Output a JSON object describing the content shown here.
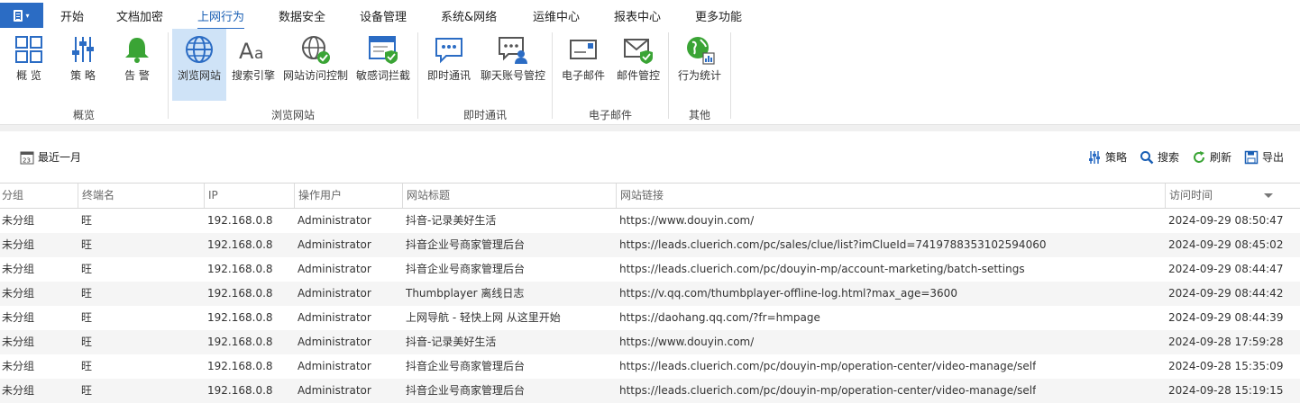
{
  "menu": {
    "items": [
      "开始",
      "文档加密",
      "上网行为",
      "数据安全",
      "设备管理",
      "系统&网络",
      "运维中心",
      "报表中心",
      "更多功能"
    ],
    "active_index": 2
  },
  "ribbon": {
    "buttons": [
      {
        "label": "概 览",
        "icon": "overview-grid-icon"
      },
      {
        "label": "策 略",
        "icon": "sliders-icon"
      },
      {
        "label": "告 警",
        "icon": "bell-icon"
      },
      {
        "label": "浏览网站",
        "icon": "globe-icon",
        "selected": true
      },
      {
        "label": "搜索引擎",
        "icon": "font-aa-icon"
      },
      {
        "label": "网站访问控制",
        "icon": "globe-check-icon"
      },
      {
        "label": "敏感词拦截",
        "icon": "window-shield-icon"
      },
      {
        "label": "即时通讯",
        "icon": "chat-bubble-icon"
      },
      {
        "label": "聊天账号管控",
        "icon": "chat-user-icon"
      },
      {
        "label": "电子邮件",
        "icon": "email-icon"
      },
      {
        "label": "邮件管控",
        "icon": "email-shield-icon"
      },
      {
        "label": "行为统计",
        "icon": "globe-chart-icon"
      }
    ],
    "groups": [
      "概览",
      "浏览网站",
      "即时通讯",
      "电子邮件",
      "其他"
    ]
  },
  "toolbar": {
    "date_icon_day": "23",
    "date_range": "最近一月",
    "actions": [
      "策略",
      "搜索",
      "刷新",
      "导出"
    ]
  },
  "table": {
    "columns": [
      "分组",
      "终端名",
      "IP",
      "操作用户",
      "网站标题",
      "网站链接",
      "访问时间"
    ],
    "rows": [
      [
        "未分组",
        "旺",
        "192.168.0.8",
        "Administrator",
        "抖音-记录美好生活",
        "https://www.douyin.com/",
        "2024-09-29 08:50:47"
      ],
      [
        "未分组",
        "旺",
        "192.168.0.8",
        "Administrator",
        "抖音企业号商家管理后台",
        "https://leads.cluerich.com/pc/sales/clue/list?imClueId=7419788353102594060",
        "2024-09-29 08:45:02"
      ],
      [
        "未分组",
        "旺",
        "192.168.0.8",
        "Administrator",
        "抖音企业号商家管理后台",
        "https://leads.cluerich.com/pc/douyin-mp/account-marketing/batch-settings",
        "2024-09-29 08:44:47"
      ],
      [
        "未分组",
        "旺",
        "192.168.0.8",
        "Administrator",
        "Thumbplayer 离线日志",
        "https://v.qq.com/thumbplayer-offline-log.html?max_age=3600",
        "2024-09-29 08:44:42"
      ],
      [
        "未分组",
        "旺",
        "192.168.0.8",
        "Administrator",
        "上网导航 - 轻快上网 从这里开始",
        "https://daohang.qq.com/?fr=hmpage",
        "2024-09-29 08:44:39"
      ],
      [
        "未分组",
        "旺",
        "192.168.0.8",
        "Administrator",
        "抖音-记录美好生活",
        "https://www.douyin.com/",
        "2024-09-28 17:59:28"
      ],
      [
        "未分组",
        "旺",
        "192.168.0.8",
        "Administrator",
        "抖音企业号商家管理后台",
        "https://leads.cluerich.com/pc/douyin-mp/operation-center/video-manage/self",
        "2024-09-28 15:35:09"
      ],
      [
        "未分组",
        "旺",
        "192.168.0.8",
        "Administrator",
        "抖音企业号商家管理后台",
        "https://leads.cluerich.com/pc/douyin-mp/operation-center/video-manage/self",
        "2024-09-28 15:19:15"
      ]
    ]
  },
  "colors": {
    "accent": "#2b6cc4",
    "selected_bg": "#cfe3f7",
    "green": "#3aa435"
  }
}
